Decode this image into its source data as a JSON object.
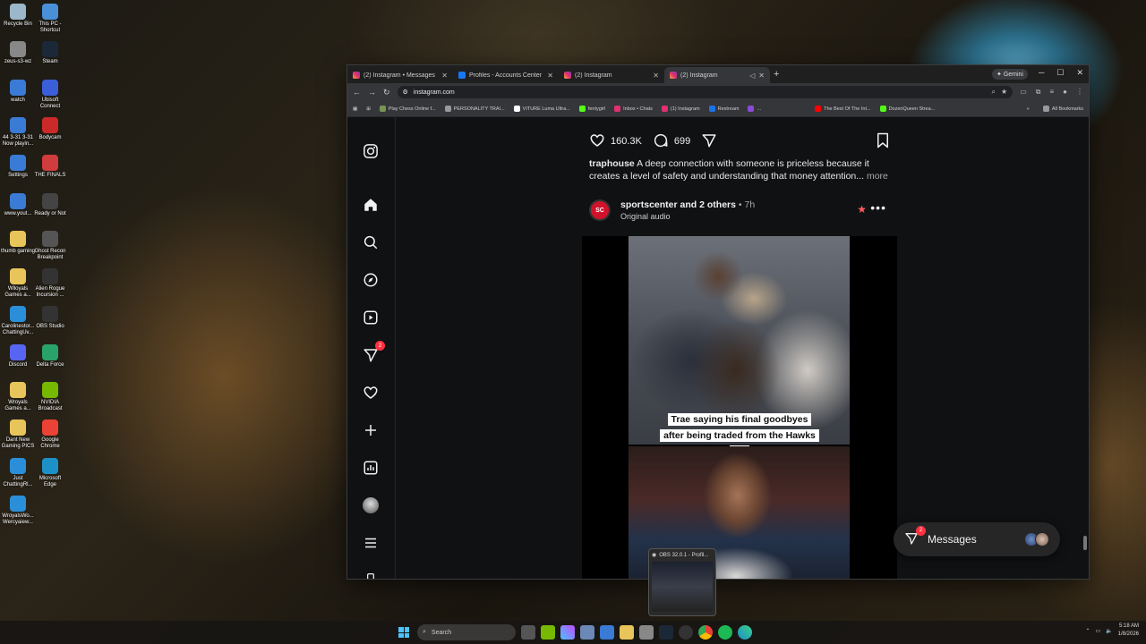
{
  "desktop": {
    "icons": [
      {
        "label": "Recycle Bin",
        "color": "#9bb7c9"
      },
      {
        "label": "This PC - Shortcut",
        "color": "#4a90d9"
      },
      {
        "label": "zeus-s3-wz",
        "color": "#888888"
      },
      {
        "label": "Steam",
        "color": "#1b2838"
      },
      {
        "label": "watch",
        "color": "#3a7bd5"
      },
      {
        "label": "Ubisoft Connect",
        "color": "#3b5fd8"
      },
      {
        "label": "44 3-31 3-31 Now playin...",
        "color": "#3a7bd5"
      },
      {
        "label": "Bodycam",
        "color": "#cc2a2a"
      },
      {
        "label": "Settings",
        "color": "#3a7bd5"
      },
      {
        "label": "THE FINALS",
        "color": "#d13c3c"
      },
      {
        "label": "www.yout...",
        "color": "#3a7bd5"
      },
      {
        "label": "Ready or Not",
        "color": "#444444"
      },
      {
        "label": "thumb gaming",
        "color": "#e8c55a"
      },
      {
        "label": "Ghost Recon Breakpoint",
        "color": "#555555"
      },
      {
        "label": "Wlloyals Games a...",
        "color": "#e8c55a"
      },
      {
        "label": "Alien Rogue Incursion ...",
        "color": "#333333"
      },
      {
        "label": "Carolinestor... ChattingUv...",
        "color": "#2a8fd8"
      },
      {
        "label": "OBS Studio",
        "color": "#333333"
      },
      {
        "label": "Discord",
        "color": "#5865f2"
      },
      {
        "label": "Delta Force",
        "color": "#2aa36a"
      },
      {
        "label": "Wroyals Games a...",
        "color": "#e8c55a"
      },
      {
        "label": "NVIDIA Broadcast",
        "color": "#76b900"
      },
      {
        "label": "Dant New Gaming PICS",
        "color": "#e8c55a"
      },
      {
        "label": "Google Chrome",
        "color": "#ea4335"
      },
      {
        "label": "Just ChattingRl...",
        "color": "#2a8fd8"
      },
      {
        "label": "Microsoft Edge",
        "color": "#1e90c8"
      },
      {
        "label": "WroyalsWo... Wercyaiew...",
        "color": "#2a8fd8"
      }
    ]
  },
  "browser": {
    "tabs": [
      {
        "label": "(2) Instagram • Messages",
        "active": false
      },
      {
        "label": "Profiles - Accounts Center",
        "active": false
      },
      {
        "label": "(2) Instagram",
        "active": false
      },
      {
        "label": "(2) Instagram",
        "active": true
      }
    ],
    "new_tab": "+",
    "gemini_label": "Gemini",
    "url": "instagram.com",
    "bookmarks": [
      "Play Chess Online f...",
      "PERSONALITY TRAI...",
      "VITURE Luma Ultra...",
      "fentygirl",
      "Inbox • Chats",
      "(1) Instagram",
      "Restream",
      "...",
      "The Best Of The Int...",
      "DozenQueen Strea..."
    ],
    "all_bookmarks": "All Bookmarks"
  },
  "instagram": {
    "likes": "160.3K",
    "comments": "699",
    "caption_user": "traphouse",
    "caption_text": " A deep connection with someone is priceless because it creates a level of safety and understanding that money attention...",
    "caption_more": " more",
    "post_account": "sportscenter",
    "post_others": " and 2 others",
    "post_time": " • 7h",
    "post_audio": "Original audio",
    "avatar_text": "SC",
    "subtitle": "Trae saying his final goodbyes after being traded from the Hawks ❤️",
    "notif_badge": "2",
    "messages_label": "Messages",
    "messages_badge": "2"
  },
  "obs_preview": {
    "title": "OBS 32.0.1 - Profil..."
  },
  "taskbar": {
    "search_placeholder": "Search",
    "time": "5:18 AM",
    "date": "1/8/2026"
  }
}
